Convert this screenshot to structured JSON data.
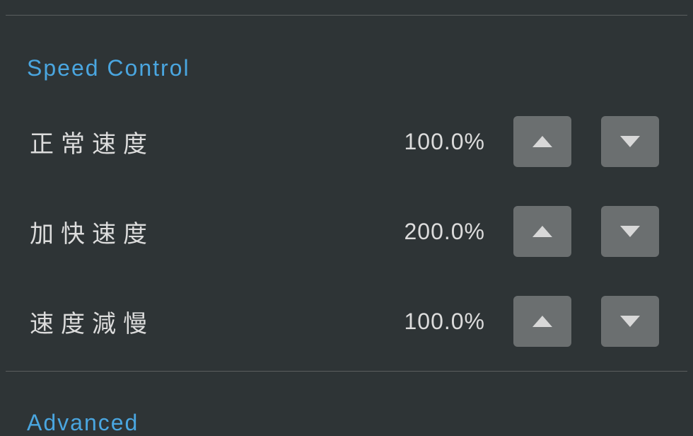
{
  "sections": {
    "speed_control": {
      "title": "Speed Control",
      "rows": [
        {
          "label": "正常速度",
          "value": "100.0%"
        },
        {
          "label": "加快速度",
          "value": "200.0%"
        },
        {
          "label": "速度減慢",
          "value": "100.0%"
        }
      ]
    },
    "advanced": {
      "title": "Advanced"
    }
  }
}
